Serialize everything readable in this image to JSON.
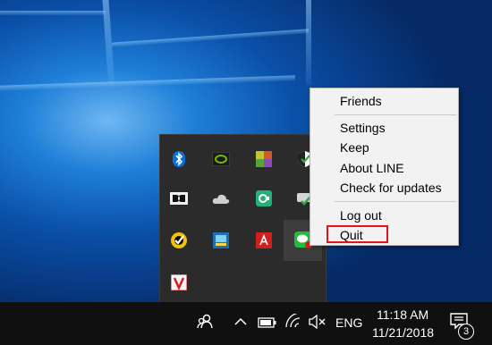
{
  "context_menu": {
    "items": [
      {
        "label": "Friends"
      },
      {
        "label": "Settings"
      },
      {
        "label": "Keep"
      },
      {
        "label": "About LINE"
      },
      {
        "label": "Check for updates"
      },
      {
        "label": "Log out"
      },
      {
        "label": "Quit",
        "highlighted": true
      }
    ],
    "highlight_color": "#e3141b"
  },
  "tray_icons": [
    "bluetooth-icon",
    "nvidia-icon",
    "color-grid-icon",
    "shield-check-icon",
    "dolby-icon",
    "onedrive-icon",
    "green-sync-icon",
    "drive-sync-icon",
    "norton-icon",
    "network-tool-icon",
    "adobe-acrobat-icon",
    "line-icon",
    "v-app-icon"
  ],
  "taskbar": {
    "language": "ENG",
    "time": "11:18 AM",
    "date": "11/21/2018",
    "notification_count": "3"
  }
}
